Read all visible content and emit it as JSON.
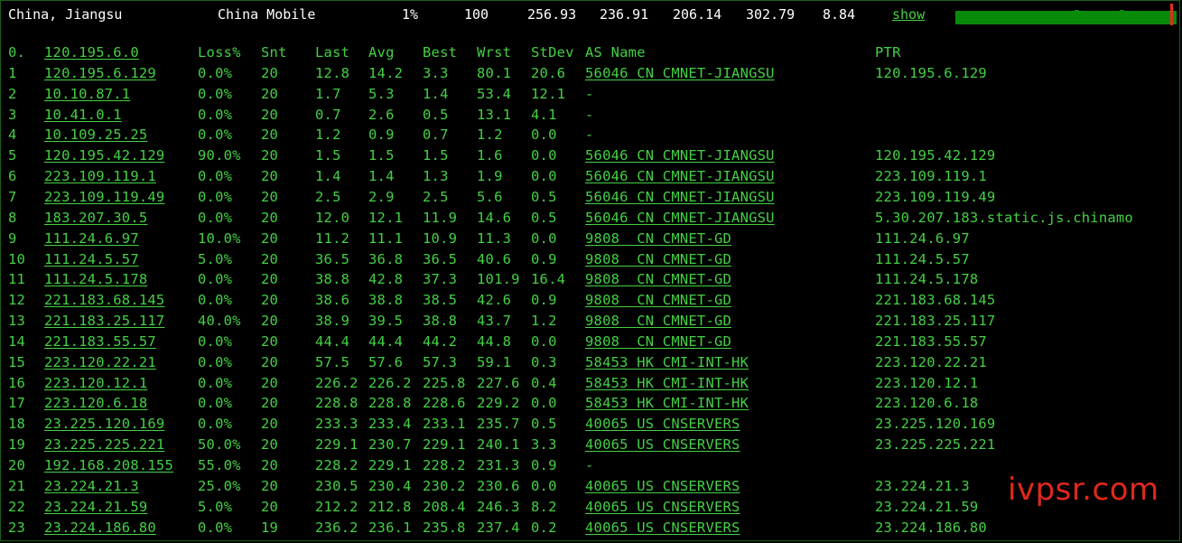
{
  "header": {
    "location": "China, Jiangsu",
    "isp": "China Mobile",
    "loss": "1%",
    "sent": "100",
    "last": "256.93",
    "avg": "236.91",
    "best": "206.14",
    "worst": "302.79",
    "stdev": "8.84",
    "show_label": "show",
    "colors": {
      "bar": "#0a8a0a",
      "marker": "#e03020",
      "text": "#44d044"
    }
  },
  "columns": {
    "idx": "0.",
    "host": "120.195.6.0",
    "loss": "Loss%",
    "snt": "Snt",
    "last": "Last",
    "avg": "Avg",
    "best": "Best",
    "wrst": "Wrst",
    "stdev": "StDev",
    "asname": "AS Name",
    "ptr": "PTR"
  },
  "rows": [
    {
      "n": "1",
      "host": "120.195.6.129",
      "loss": "0.0%",
      "snt": "20",
      "last": "12.8",
      "avg": "14.2",
      "best": "3.3",
      "wrst": "80.1",
      "stdev": "20.6",
      "as": "56046 CN CMNET-JIANGSU",
      "ptr": "120.195.6.129"
    },
    {
      "n": "2",
      "host": "10.10.87.1",
      "loss": "0.0%",
      "snt": "20",
      "last": "1.7",
      "avg": "5.3",
      "best": "1.4",
      "wrst": "53.4",
      "stdev": "12.1",
      "as": "-",
      "ptr": ""
    },
    {
      "n": "3",
      "host": "10.41.0.1",
      "loss": "0.0%",
      "snt": "20",
      "last": "0.7",
      "avg": "2.6",
      "best": "0.5",
      "wrst": "13.1",
      "stdev": "4.1",
      "as": "-",
      "ptr": ""
    },
    {
      "n": "4",
      "host": "10.109.25.25",
      "loss": "0.0%",
      "snt": "20",
      "last": "1.2",
      "avg": "0.9",
      "best": "0.7",
      "wrst": "1.2",
      "stdev": "0.0",
      "as": "-",
      "ptr": ""
    },
    {
      "n": "5",
      "host": "120.195.42.129",
      "loss": "90.0%",
      "snt": "20",
      "last": "1.5",
      "avg": "1.5",
      "best": "1.5",
      "wrst": "1.6",
      "stdev": "0.0",
      "as": "56046 CN CMNET-JIANGSU",
      "ptr": "120.195.42.129"
    },
    {
      "n": "6",
      "host": "223.109.119.1",
      "loss": "0.0%",
      "snt": "20",
      "last": "1.4",
      "avg": "1.4",
      "best": "1.3",
      "wrst": "1.9",
      "stdev": "0.0",
      "as": "56046 CN CMNET-JIANGSU",
      "ptr": "223.109.119.1"
    },
    {
      "n": "7",
      "host": "223.109.119.49",
      "loss": "0.0%",
      "snt": "20",
      "last": "2.5",
      "avg": "2.9",
      "best": "2.5",
      "wrst": "5.6",
      "stdev": "0.5",
      "as": "56046 CN CMNET-JIANGSU",
      "ptr": "223.109.119.49"
    },
    {
      "n": "8",
      "host": "183.207.30.5",
      "loss": "0.0%",
      "snt": "20",
      "last": "12.0",
      "avg": "12.1",
      "best": "11.9",
      "wrst": "14.6",
      "stdev": "0.5",
      "as": "56046 CN CMNET-JIANGSU",
      "ptr": "5.30.207.183.static.js.chinamo"
    },
    {
      "n": "9",
      "host": "111.24.6.97",
      "loss": "10.0%",
      "snt": "20",
      "last": "11.2",
      "avg": "11.1",
      "best": "10.9",
      "wrst": "11.3",
      "stdev": "0.0",
      "as": "9808  CN CMNET-GD",
      "ptr": "111.24.6.97"
    },
    {
      "n": "10",
      "host": "111.24.5.57",
      "loss": "5.0%",
      "snt": "20",
      "last": "36.5",
      "avg": "36.8",
      "best": "36.5",
      "wrst": "40.6",
      "stdev": "0.9",
      "as": "9808  CN CMNET-GD",
      "ptr": "111.24.5.57"
    },
    {
      "n": "11",
      "host": "111.24.5.178",
      "loss": "0.0%",
      "snt": "20",
      "last": "38.8",
      "avg": "42.8",
      "best": "37.3",
      "wrst": "101.9",
      "stdev": "16.4",
      "as": "9808  CN CMNET-GD",
      "ptr": "111.24.5.178"
    },
    {
      "n": "12",
      "host": "221.183.68.145",
      "loss": "0.0%",
      "snt": "20",
      "last": "38.6",
      "avg": "38.8",
      "best": "38.5",
      "wrst": "42.6",
      "stdev": "0.9",
      "as": "9808  CN CMNET-GD",
      "ptr": "221.183.68.145"
    },
    {
      "n": "13",
      "host": "221.183.25.117",
      "loss": "40.0%",
      "snt": "20",
      "last": "38.9",
      "avg": "39.5",
      "best": "38.8",
      "wrst": "43.7",
      "stdev": "1.2",
      "as": "9808  CN CMNET-GD",
      "ptr": "221.183.25.117"
    },
    {
      "n": "14",
      "host": "221.183.55.57",
      "loss": "0.0%",
      "snt": "20",
      "last": "44.4",
      "avg": "44.4",
      "best": "44.2",
      "wrst": "44.8",
      "stdev": "0.0",
      "as": "9808  CN CMNET-GD",
      "ptr": "221.183.55.57"
    },
    {
      "n": "15",
      "host": "223.120.22.21",
      "loss": "0.0%",
      "snt": "20",
      "last": "57.5",
      "avg": "57.6",
      "best": "57.3",
      "wrst": "59.1",
      "stdev": "0.3",
      "as": "58453 HK CMI-INT-HK",
      "ptr": "223.120.22.21"
    },
    {
      "n": "16",
      "host": "223.120.12.1",
      "loss": "0.0%",
      "snt": "20",
      "last": "226.2",
      "avg": "226.2",
      "best": "225.8",
      "wrst": "227.6",
      "stdev": "0.4",
      "as": "58453 HK CMI-INT-HK",
      "ptr": "223.120.12.1"
    },
    {
      "n": "17",
      "host": "223.120.6.18",
      "loss": "0.0%",
      "snt": "20",
      "last": "228.8",
      "avg": "228.8",
      "best": "228.6",
      "wrst": "229.2",
      "stdev": "0.0",
      "as": "58453 HK CMI-INT-HK",
      "ptr": "223.120.6.18"
    },
    {
      "n": "18",
      "host": "23.225.120.169",
      "loss": "0.0%",
      "snt": "20",
      "last": "233.3",
      "avg": "233.4",
      "best": "233.1",
      "wrst": "235.7",
      "stdev": "0.5",
      "as": "40065 US CNSERVERS",
      "ptr": "23.225.120.169"
    },
    {
      "n": "19",
      "host": "23.225.225.221",
      "loss": "50.0%",
      "snt": "20",
      "last": "229.1",
      "avg": "230.7",
      "best": "229.1",
      "wrst": "240.1",
      "stdev": "3.3",
      "as": "40065 US CNSERVERS",
      "ptr": "23.225.225.221"
    },
    {
      "n": "20",
      "host": "192.168.208.155",
      "loss": "55.0%",
      "snt": "20",
      "last": "228.2",
      "avg": "229.1",
      "best": "228.2",
      "wrst": "231.3",
      "stdev": "0.9",
      "as": "-",
      "ptr": ""
    },
    {
      "n": "21",
      "host": "23.224.21.3",
      "loss": "25.0%",
      "snt": "20",
      "last": "230.5",
      "avg": "230.4",
      "best": "230.2",
      "wrst": "230.6",
      "stdev": "0.0",
      "as": "40065 US CNSERVERS",
      "ptr": "23.224.21.3"
    },
    {
      "n": "22",
      "host": "23.224.21.59",
      "loss": "5.0%",
      "snt": "20",
      "last": "212.2",
      "avg": "212.8",
      "best": "208.4",
      "wrst": "246.3",
      "stdev": "8.2",
      "as": "40065 US CNSERVERS",
      "ptr": "23.224.21.59"
    },
    {
      "n": "23",
      "host": "23.224.186.80",
      "loss": "0.0%",
      "snt": "19",
      "last": "236.2",
      "avg": "236.1",
      "best": "235.8",
      "wrst": "237.4",
      "stdev": "0.2",
      "as": "40065 US CNSERVERS",
      "ptr": "23.224.186.80"
    }
  ],
  "watermark": "ivpsr.com"
}
